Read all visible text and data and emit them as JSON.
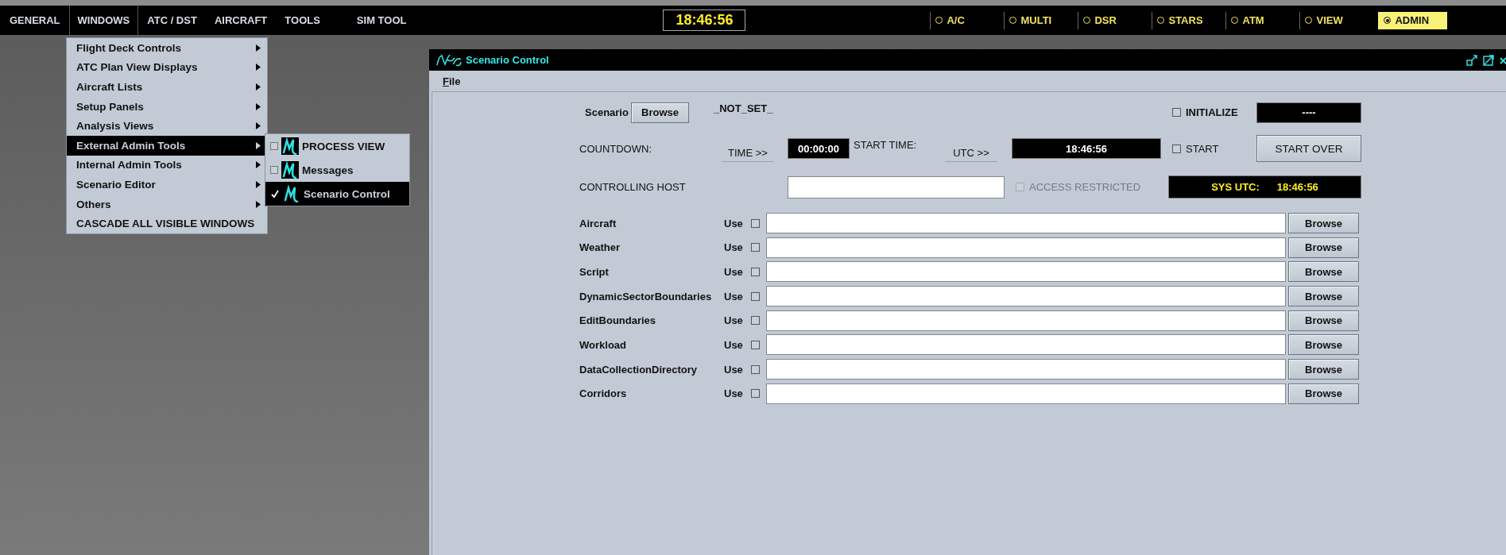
{
  "menubar": {
    "menus": [
      {
        "label": "GENERAL",
        "selected": false
      },
      {
        "label": "WINDOWS",
        "selected": true
      },
      {
        "label": "ATC / DST",
        "selected": false
      },
      {
        "label": "AIRCRAFT",
        "selected": false
      },
      {
        "label": "TOOLS",
        "selected": false
      },
      {
        "label": "SIM TOOL",
        "selected": false
      }
    ],
    "clock": "18:46:56",
    "modes": [
      {
        "label": "A/C",
        "selected": false
      },
      {
        "label": "MULTI",
        "selected": false
      },
      {
        "label": "DSR",
        "selected": false
      },
      {
        "label": "STARS",
        "selected": false
      },
      {
        "label": "ATM",
        "selected": false
      },
      {
        "label": "VIEW",
        "selected": false
      },
      {
        "label": "ADMIN",
        "selected": true
      }
    ]
  },
  "windows_menu": {
    "items": [
      {
        "label": "Flight Deck Controls",
        "submenu": true,
        "selected": false
      },
      {
        "label": "ATC Plan View Displays",
        "submenu": true,
        "selected": false
      },
      {
        "label": "Aircraft Lists",
        "submenu": true,
        "selected": false
      },
      {
        "label": "Setup Panels",
        "submenu": true,
        "selected": false
      },
      {
        "label": "Analysis Views",
        "submenu": true,
        "selected": false
      },
      {
        "label": "External Admin Tools",
        "submenu": true,
        "selected": true
      },
      {
        "label": "Internal Admin Tools",
        "submenu": true,
        "selected": false
      },
      {
        "label": "Scenario Editor",
        "submenu": true,
        "selected": false
      },
      {
        "label": "Others",
        "submenu": true,
        "selected": false
      },
      {
        "label": "CASCADE ALL VISIBLE WINDOWS",
        "submenu": false,
        "selected": false
      }
    ]
  },
  "submenu": {
    "items": [
      {
        "label": "PROCESS VIEW",
        "checked": false,
        "selected": false
      },
      {
        "label": "Messages",
        "checked": false,
        "selected": false
      },
      {
        "label": "Scenario Control",
        "checked": true,
        "selected": true
      }
    ]
  },
  "window": {
    "title": "Scenario Control",
    "menu": [
      "File"
    ],
    "scenario": {
      "label": "Scenario",
      "button": "Browse",
      "value": "_NOT_SET_"
    },
    "initialize": {
      "label": "INITIALIZE",
      "checked": false
    },
    "status_display": "----",
    "countdown": {
      "label": "COUNTDOWN:",
      "button": "TIME >>",
      "value": "00:00:00"
    },
    "start_time": {
      "label": "START TIME:",
      "button": "UTC >>",
      "value": "18:46:56"
    },
    "start": {
      "label": "START",
      "checked": false
    },
    "start_over": "START OVER",
    "controlling_host": {
      "label": "CONTROLLING HOST"
    },
    "access_restricted": {
      "label": "ACCESS RESTRICTED",
      "checked": false,
      "disabled": true
    },
    "sys_utc": {
      "label": "SYS UTC:",
      "value": "18:46:56"
    },
    "files": [
      {
        "label": "Aircraft",
        "use": "Use",
        "checked": false,
        "button": "Browse"
      },
      {
        "label": "Weather",
        "use": "Use",
        "checked": false,
        "button": "Browse"
      },
      {
        "label": "Script",
        "use": "Use",
        "checked": false,
        "button": "Browse"
      },
      {
        "label": "DynamicSectorBoundaries",
        "use": "Use",
        "checked": false,
        "button": "Browse"
      },
      {
        "label": "EditBoundaries",
        "use": "Use",
        "checked": false,
        "button": "Browse"
      },
      {
        "label": "Workload",
        "use": "Use",
        "checked": false,
        "button": "Browse"
      },
      {
        "label": "DataCollectionDirectory",
        "use": "Use",
        "checked": false,
        "button": "Browse"
      },
      {
        "label": "Corridors",
        "use": "Use",
        "checked": false,
        "button": "Browse"
      }
    ]
  }
}
